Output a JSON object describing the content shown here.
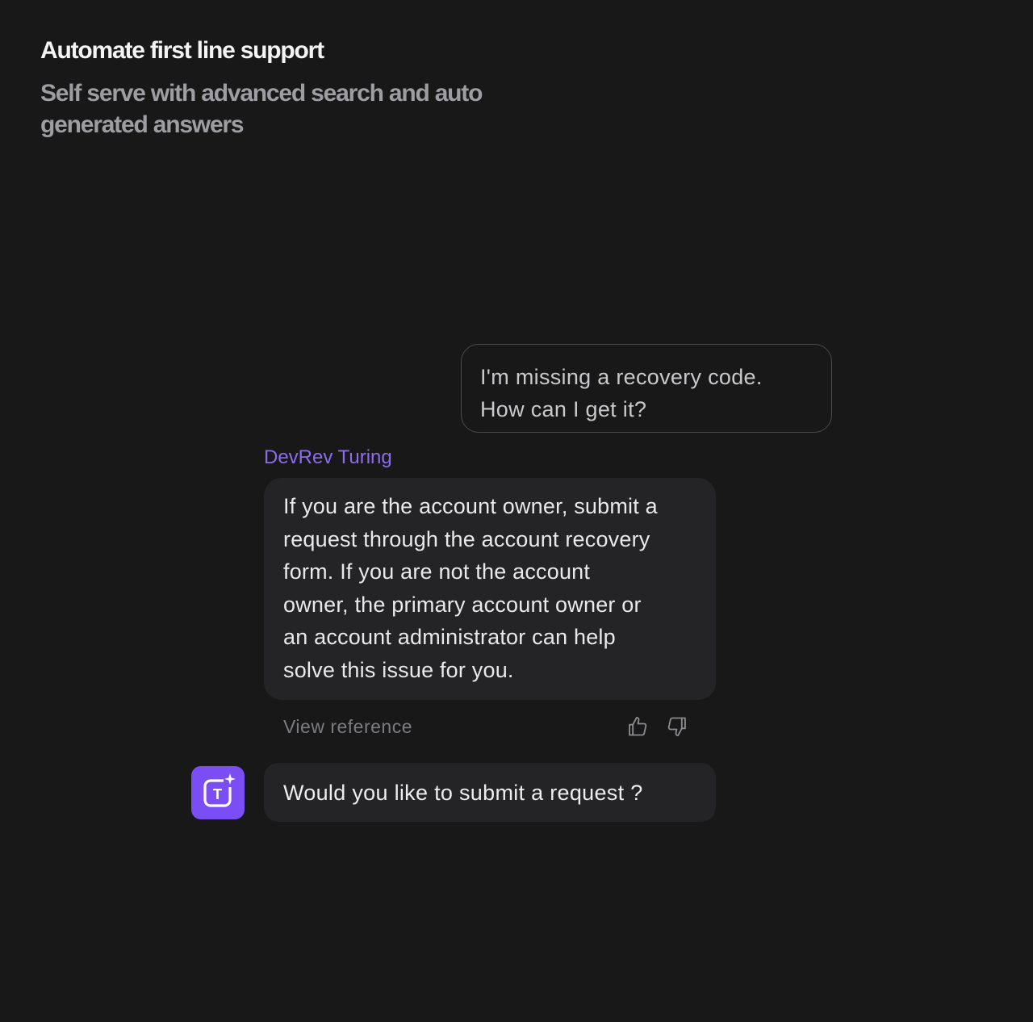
{
  "header": {
    "title": "Automate first line support",
    "subtitle_lines": [
      "Self serve with advanced search and auto",
      "generated answers"
    ]
  },
  "chat": {
    "user_message_lines": [
      "I'm missing a recovery code.",
      "How can I get it?"
    ],
    "bot_name": "DevRev Turing",
    "bot_answer_lines": [
      "If you are the account owner, submit a",
      "request through the account recovery",
      "form. If you are not the account",
      "owner, the primary account owner or",
      "an account administrator can help",
      "solve this issue for you."
    ],
    "view_reference_label": "View reference",
    "followup_prompt": "Would you like to submit a request ?",
    "avatar_letter": "T"
  },
  "icons": {
    "thumbs_up": "thumbs-up-icon",
    "thumbs_down": "thumbs-down-icon",
    "avatar": "turing-avatar-icon"
  },
  "colors": {
    "background": "#181819",
    "accent": "#7b4df5",
    "bot_name": "#8b6cf0",
    "bubble": "#242426"
  }
}
